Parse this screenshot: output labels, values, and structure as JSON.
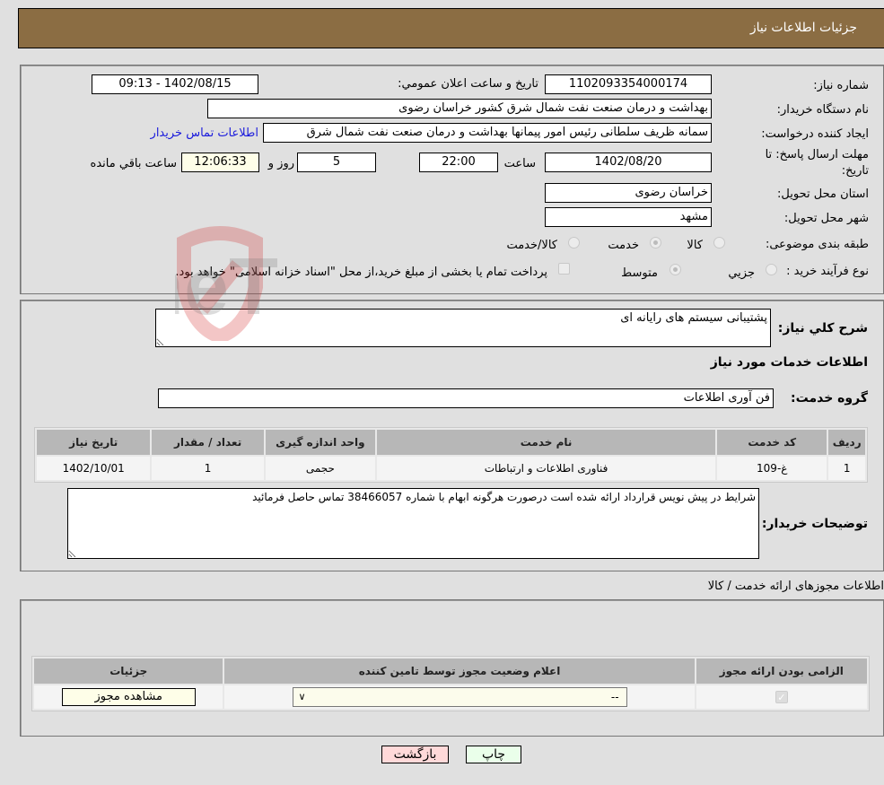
{
  "header": {
    "title": "جزئیات اطلاعات نیاز"
  },
  "details": {
    "need_number_label": "شماره نیاز:",
    "need_number": "1102093354000174",
    "announce_label": "تاریخ و ساعت اعلان عمومي:",
    "announce_value": "1402/08/15 - 09:13",
    "buyer_org_label": "نام دستگاه خريدار:",
    "buyer_org": "بهداشت و درمان صنعت نفت شمال شرق کشور   خراسان رضوی",
    "requester_label": "ایجاد کننده درخواست:",
    "requester": "سمانه ظریف سلطانی رئیس امور پیمانها بهداشت و درمان صنعت نفت شمال شرق",
    "buyer_contact_link": "اطلاعات تماس خريدار",
    "deadline_label": "مهلت ارسال پاسخ: تا تاریخ:",
    "deadline_date": "1402/08/20",
    "time_label": "ساعت",
    "deadline_time": "22:00",
    "days_value": "5",
    "days_label": "روز و",
    "remaining_time": "12:06:33",
    "remaining_label": "ساعت باقي مانده",
    "province_label": "استان محل تحویل:",
    "province": "خراسان رضوی",
    "city_label": "شهر محل تحویل:",
    "city": "مشهد",
    "category_label": "طبقه بندی موضوعی:",
    "category_options": [
      {
        "label": "کالا",
        "selected": false
      },
      {
        "label": "خدمت",
        "selected": true
      },
      {
        "label": "کالا/خدمت",
        "selected": false
      }
    ],
    "process_label": "نوع فرآیند خرید :",
    "process_options": [
      {
        "label": "جزيي",
        "selected": false
      },
      {
        "label": "متوسط",
        "selected": true
      }
    ],
    "treasury_note": "پرداخت تمام یا بخشی از مبلغ خرید،از محل \"اسناد خزانه اسلامی\" خواهد بود."
  },
  "description": {
    "label": "شرح کلي نياز:",
    "value": "پشتیبانی سیستم های رایانه ای",
    "services_heading": "اطلاعات خدمات مورد نياز",
    "service_group_label": "گروه خدمت:",
    "service_group": "فن آوری اطلاعات"
  },
  "services_table": {
    "columns": [
      "ردیف",
      "کد خدمت",
      "نام خدمت",
      "واحد اندازه گیری",
      "تعداد / مقدار",
      "تاریخ نیاز"
    ],
    "rows": [
      [
        "1",
        "غ-109",
        "فناوری اطلاعات و ارتباطات",
        "حجمی",
        "1",
        "1402/10/01"
      ]
    ]
  },
  "buyer_notes": {
    "label": "توضیحات خریدار:",
    "value": "شرایط در پیش نویس قرارداد ارائه شده است درصورت هرگونه ابهام با شماره 38466057 تماس حاصل فرمائید"
  },
  "permits": {
    "heading": "اطلاعات مجوزهای ارائه خدمت / کالا",
    "columns": [
      "الزامی بودن ارائه مجوز",
      "اعلام وضعیت مجوز توسط تامین کننده",
      "جزئیات"
    ],
    "row": {
      "required_checked": true,
      "status_select": "--",
      "view_button": "مشاهده مجوز"
    }
  },
  "actions": {
    "print": "چاپ",
    "back": "بازگشت"
  },
  "watermark": {
    "text": "AriaTender.neT"
  },
  "colors": {
    "header_bg": "#8b6d43",
    "print_bg": "#eaffea",
    "back_bg": "#ffd9d9",
    "link": "#1a1adc"
  }
}
